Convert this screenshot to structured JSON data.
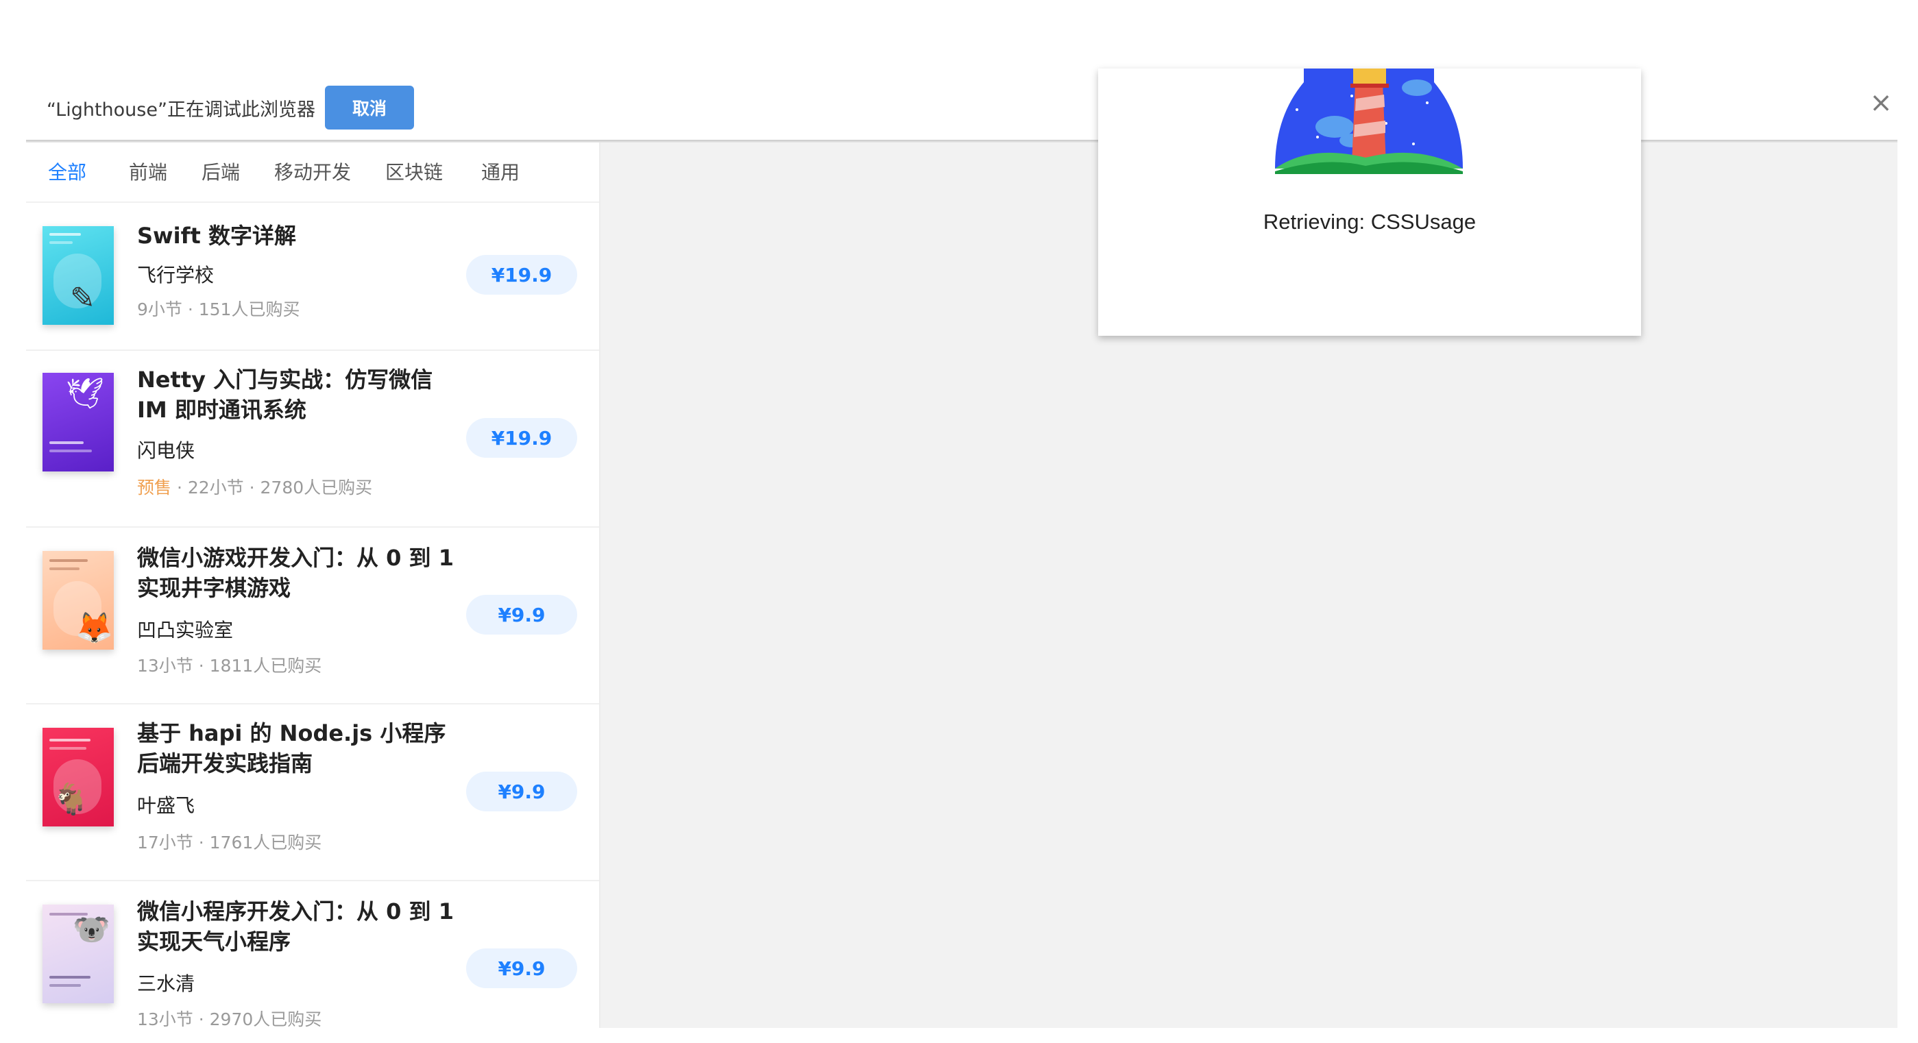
{
  "infobar": {
    "message": "“Lighthouse”正在调试此浏览器",
    "cancel_label": "取消",
    "close_glyph": "×"
  },
  "tabs": [
    {
      "label": "全部",
      "active": true
    },
    {
      "label": "前端",
      "active": false
    },
    {
      "label": "后端",
      "active": false
    },
    {
      "label": "移动开发",
      "active": false
    },
    {
      "label": "区块链",
      "active": false
    },
    {
      "label": "通用",
      "active": false
    }
  ],
  "books": [
    {
      "title": "Swift 数字详解",
      "author": "飞行学校",
      "presale": "",
      "meta": "9小节 · 151人已购买",
      "price": "¥19.9",
      "cover_color": "#3fd0e0",
      "cover_icon": "reading-figure-icon"
    },
    {
      "title": "Netty 入门与实战：仿写微信 IM 即时通讯系统",
      "author": "闪电侠",
      "presale": "预售",
      "meta": " · 22小节 · 2780人已购买",
      "price": "¥19.9",
      "cover_color": "#7a35e6",
      "cover_icon": "bird-icon"
    },
    {
      "title": "微信小游戏开发入门：从 0 到 1 实现井字棋游戏",
      "author": "凹凸实验室",
      "presale": "",
      "meta": "13小节 · 1811人已购买",
      "price": "¥9.9",
      "cover_color": "#ffc9a6",
      "cover_icon": "fox-icon"
    },
    {
      "title": "基于 hapi 的 Node.js 小程序后端开发实践指南",
      "author": "叶盛飞",
      "presale": "",
      "meta": "17小节 · 1761人已购买",
      "price": "¥9.9",
      "cover_color": "#f0285a",
      "cover_icon": "goat-icon"
    },
    {
      "title": "微信小程序开发入门：从 0 到 1 实现天气小程序",
      "author": "三水清",
      "presale": "",
      "meta": "13小节 · 2970人已购买",
      "price": "¥9.9",
      "cover_color": "#e9d9f4",
      "cover_icon": "koala-icon"
    }
  ],
  "dialog": {
    "status_text": "Retrieving: CSSUsage",
    "logo": "lighthouse-logo-icon"
  }
}
